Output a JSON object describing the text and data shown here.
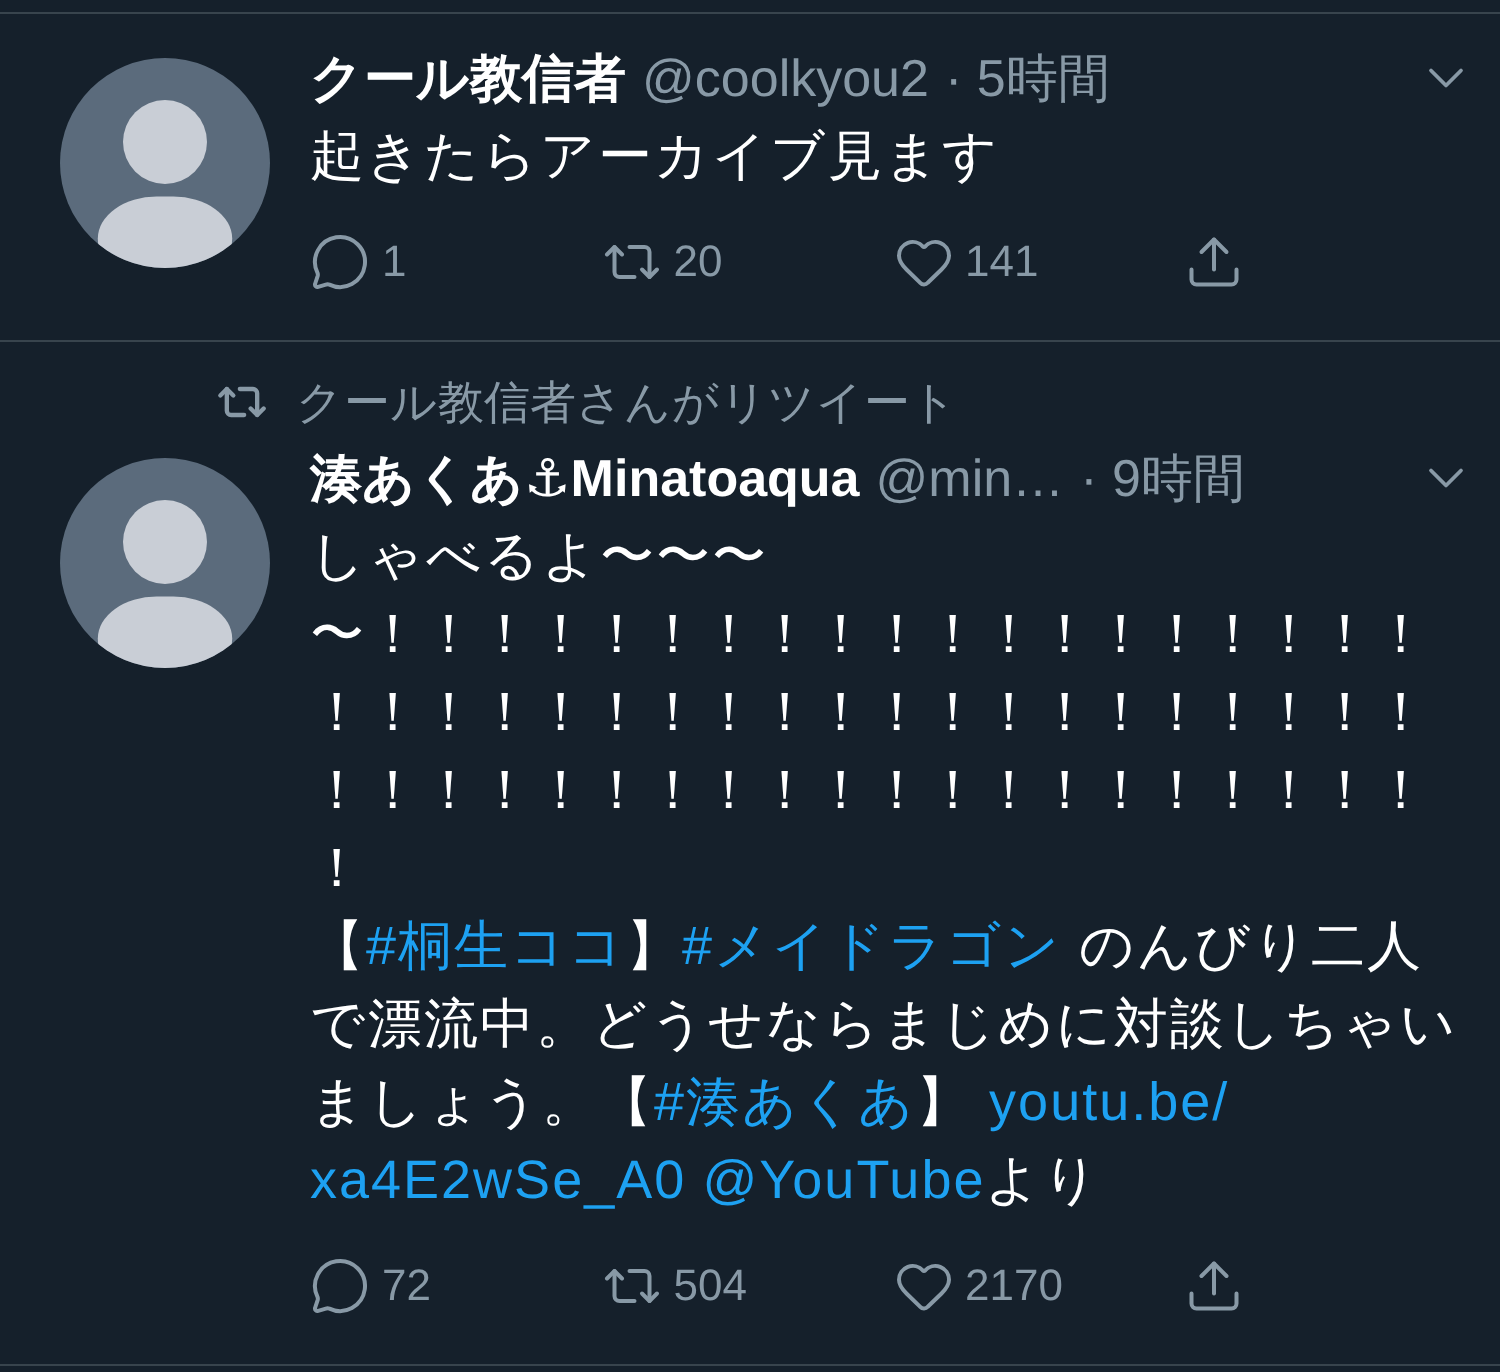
{
  "tweets": [
    {
      "avatar": {
        "kind": "picture"
      },
      "name": "クール教信者",
      "handle": "@coolkyou2",
      "time": "· 5時間",
      "lines": [
        [
          {
            "kind": "text",
            "text": "起きたらアーカイブ見ます"
          }
        ]
      ],
      "actions": [
        {
          "kind": "reply",
          "count": "1"
        },
        {
          "kind": "retweet",
          "count": "20"
        },
        {
          "kind": "like",
          "count": "141"
        },
        {
          "kind": "share"
        }
      ]
    },
    {
      "retweeted_by": "クール教信者さんがリツイート",
      "avatar": {
        "kind": "picture"
      },
      "name": "湊あくあ⚓Minatoaqua",
      "handle": "@min…",
      "time": "· 9時間",
      "lines": [
        [
          {
            "kind": "text",
            "text": "しゃべるよ〜〜〜"
          }
        ],
        [
          {
            "kind": "text",
            "text": "〜！！！！！！！！！！！！！！！！！！！"
          }
        ],
        [
          {
            "kind": "text",
            "text": "！！！！！！！！！！！！！！！！！！！！"
          }
        ],
        [
          {
            "kind": "text",
            "text": "！！！！！！！！！！！！！！！！！！！！"
          }
        ],
        [
          {
            "kind": "text",
            "text": "！"
          }
        ],
        [
          {
            "kind": "text",
            "text": "【"
          },
          {
            "kind": "link",
            "text": "#桐生ココ"
          },
          {
            "kind": "text",
            "text": "】"
          },
          {
            "kind": "link",
            "text": "#メイドラゴン"
          },
          {
            "kind": "text",
            "text": " のんびり二人"
          }
        ],
        [
          {
            "kind": "text",
            "text": "で漂流中。どうせならまじめに対談しちゃい"
          }
        ],
        [
          {
            "kind": "text",
            "text": "ましょう。【"
          },
          {
            "kind": "link",
            "text": "#湊あくあ"
          },
          {
            "kind": "text",
            "text": "】 "
          },
          {
            "kind": "link",
            "text": "youtu.be/"
          }
        ],
        [
          {
            "kind": "link",
            "text": "xa4E2wSe_A0"
          },
          {
            "kind": "link",
            "text": "@YouTube"
          },
          {
            "kind": "text",
            "text": "より"
          }
        ]
      ],
      "actions": [
        {
          "kind": "reply",
          "count": "72"
        },
        {
          "kind": "retweet",
          "count": "504"
        },
        {
          "kind": "like",
          "count": "2170"
        },
        {
          "kind": "share"
        }
      ]
    }
  ]
}
